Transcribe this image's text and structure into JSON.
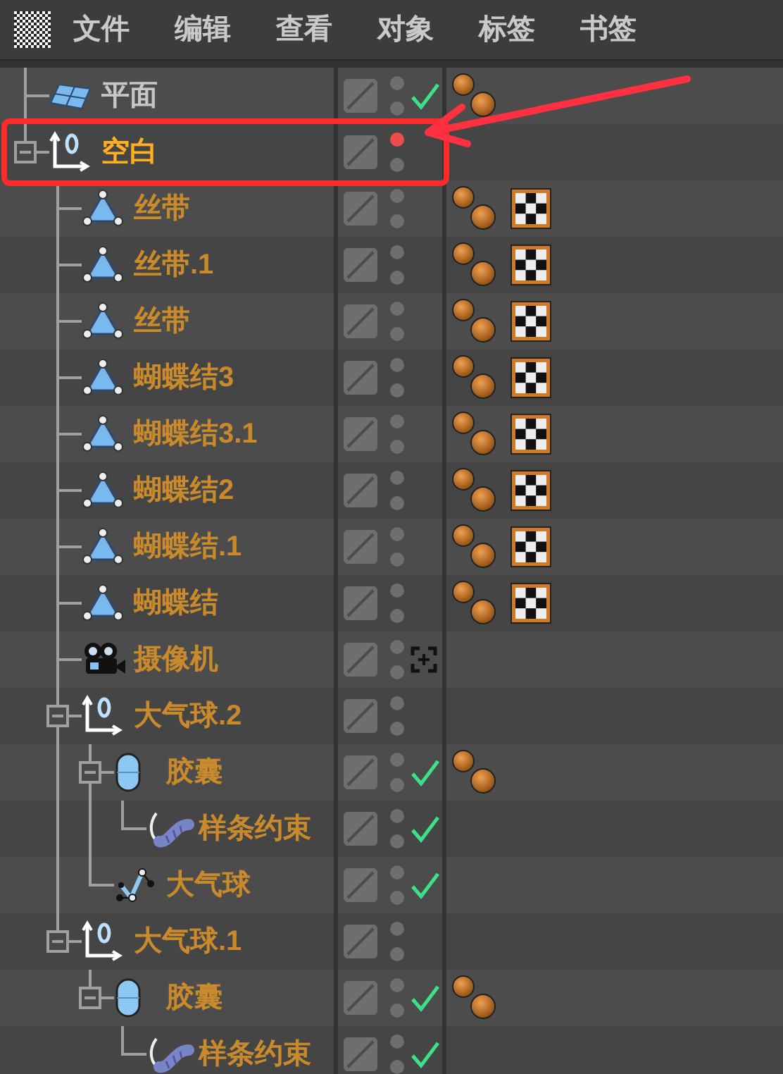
{
  "menu": [
    "文件",
    "编辑",
    "查看",
    "对象",
    "标签",
    "书签"
  ],
  "objects": [
    {
      "name": "平面",
      "kind": "plane",
      "selected": false,
      "highlighted": false,
      "editor_hidden": false,
      "enabled": true,
      "tags": [
        {
          "kind": "material"
        }
      ]
    },
    {
      "name": "空白",
      "kind": "null",
      "selected": true,
      "highlighted": true,
      "expanded": true,
      "editor_hidden": true,
      "enabled": false,
      "children": [
        {
          "name": "丝带",
          "kind": "polygon",
          "selected": false,
          "highlighted": false,
          "editor_hidden": false,
          "enabled": false,
          "tags": [
            {
              "kind": "material"
            },
            {
              "kind": "texture"
            }
          ]
        },
        {
          "name": "丝带.1",
          "kind": "polygon",
          "selected": false,
          "highlighted": false,
          "editor_hidden": false,
          "enabled": false,
          "tags": [
            {
              "kind": "material"
            },
            {
              "kind": "texture"
            }
          ]
        },
        {
          "name": "丝带",
          "kind": "polygon",
          "selected": false,
          "highlighted": false,
          "editor_hidden": false,
          "enabled": false,
          "tags": [
            {
              "kind": "material"
            },
            {
              "kind": "texture"
            }
          ]
        },
        {
          "name": "蝴蝶结3",
          "kind": "polygon",
          "selected": false,
          "highlighted": false,
          "editor_hidden": false,
          "enabled": false,
          "tags": [
            {
              "kind": "material"
            },
            {
              "kind": "texture"
            }
          ]
        },
        {
          "name": "蝴蝶结3.1",
          "kind": "polygon",
          "selected": false,
          "highlighted": false,
          "editor_hidden": false,
          "enabled": false,
          "tags": [
            {
              "kind": "material"
            },
            {
              "kind": "texture"
            }
          ]
        },
        {
          "name": "蝴蝶结2",
          "kind": "polygon",
          "selected": false,
          "highlighted": false,
          "editor_hidden": false,
          "enabled": false,
          "tags": [
            {
              "kind": "material"
            },
            {
              "kind": "texture"
            }
          ]
        },
        {
          "name": "蝴蝶结.1",
          "kind": "polygon",
          "selected": false,
          "highlighted": false,
          "editor_hidden": false,
          "enabled": false,
          "tags": [
            {
              "kind": "material"
            },
            {
              "kind": "texture"
            }
          ]
        },
        {
          "name": "蝴蝶结",
          "kind": "polygon",
          "selected": false,
          "highlighted": false,
          "editor_hidden": false,
          "enabled": false,
          "tags": [
            {
              "kind": "material"
            },
            {
              "kind": "texture"
            }
          ]
        },
        {
          "name": "摄像机",
          "kind": "camera",
          "selected": false,
          "highlighted": false,
          "editor_hidden": false,
          "enabled": false
        },
        {
          "name": "大气球.2",
          "kind": "null",
          "selected": false,
          "highlighted": false,
          "expanded": true,
          "editor_hidden": false,
          "enabled": false,
          "children": [
            {
              "name": "胶囊",
              "kind": "capsule",
              "selected": false,
              "highlighted": false,
              "expanded": true,
              "editor_hidden": false,
              "enabled": true,
              "tags": [
                {
                  "kind": "material"
                }
              ],
              "children": [
                {
                  "name": "样条约束",
                  "kind": "spline_constraint",
                  "selected": false,
                  "highlighted": false,
                  "editor_hidden": false,
                  "enabled": true
                }
              ]
            },
            {
              "name": "大气球",
              "kind": "spline",
              "selected": false,
              "highlighted": false,
              "editor_hidden": false,
              "enabled": true
            }
          ]
        },
        {
          "name": "大气球.1",
          "kind": "null",
          "selected": false,
          "highlighted": false,
          "expanded": true,
          "editor_hidden": false,
          "enabled": false,
          "children": [
            {
              "name": "胶囊",
              "kind": "capsule",
              "selected": false,
              "highlighted": false,
              "expanded": true,
              "editor_hidden": false,
              "enabled": true,
              "tags": [
                {
                  "kind": "material"
                }
              ],
              "children": [
                {
                  "name": "样条约束",
                  "kind": "spline_constraint",
                  "selected": false,
                  "highlighted": false,
                  "editor_hidden": false,
                  "enabled": true
                }
              ]
            }
          ]
        }
      ]
    }
  ]
}
